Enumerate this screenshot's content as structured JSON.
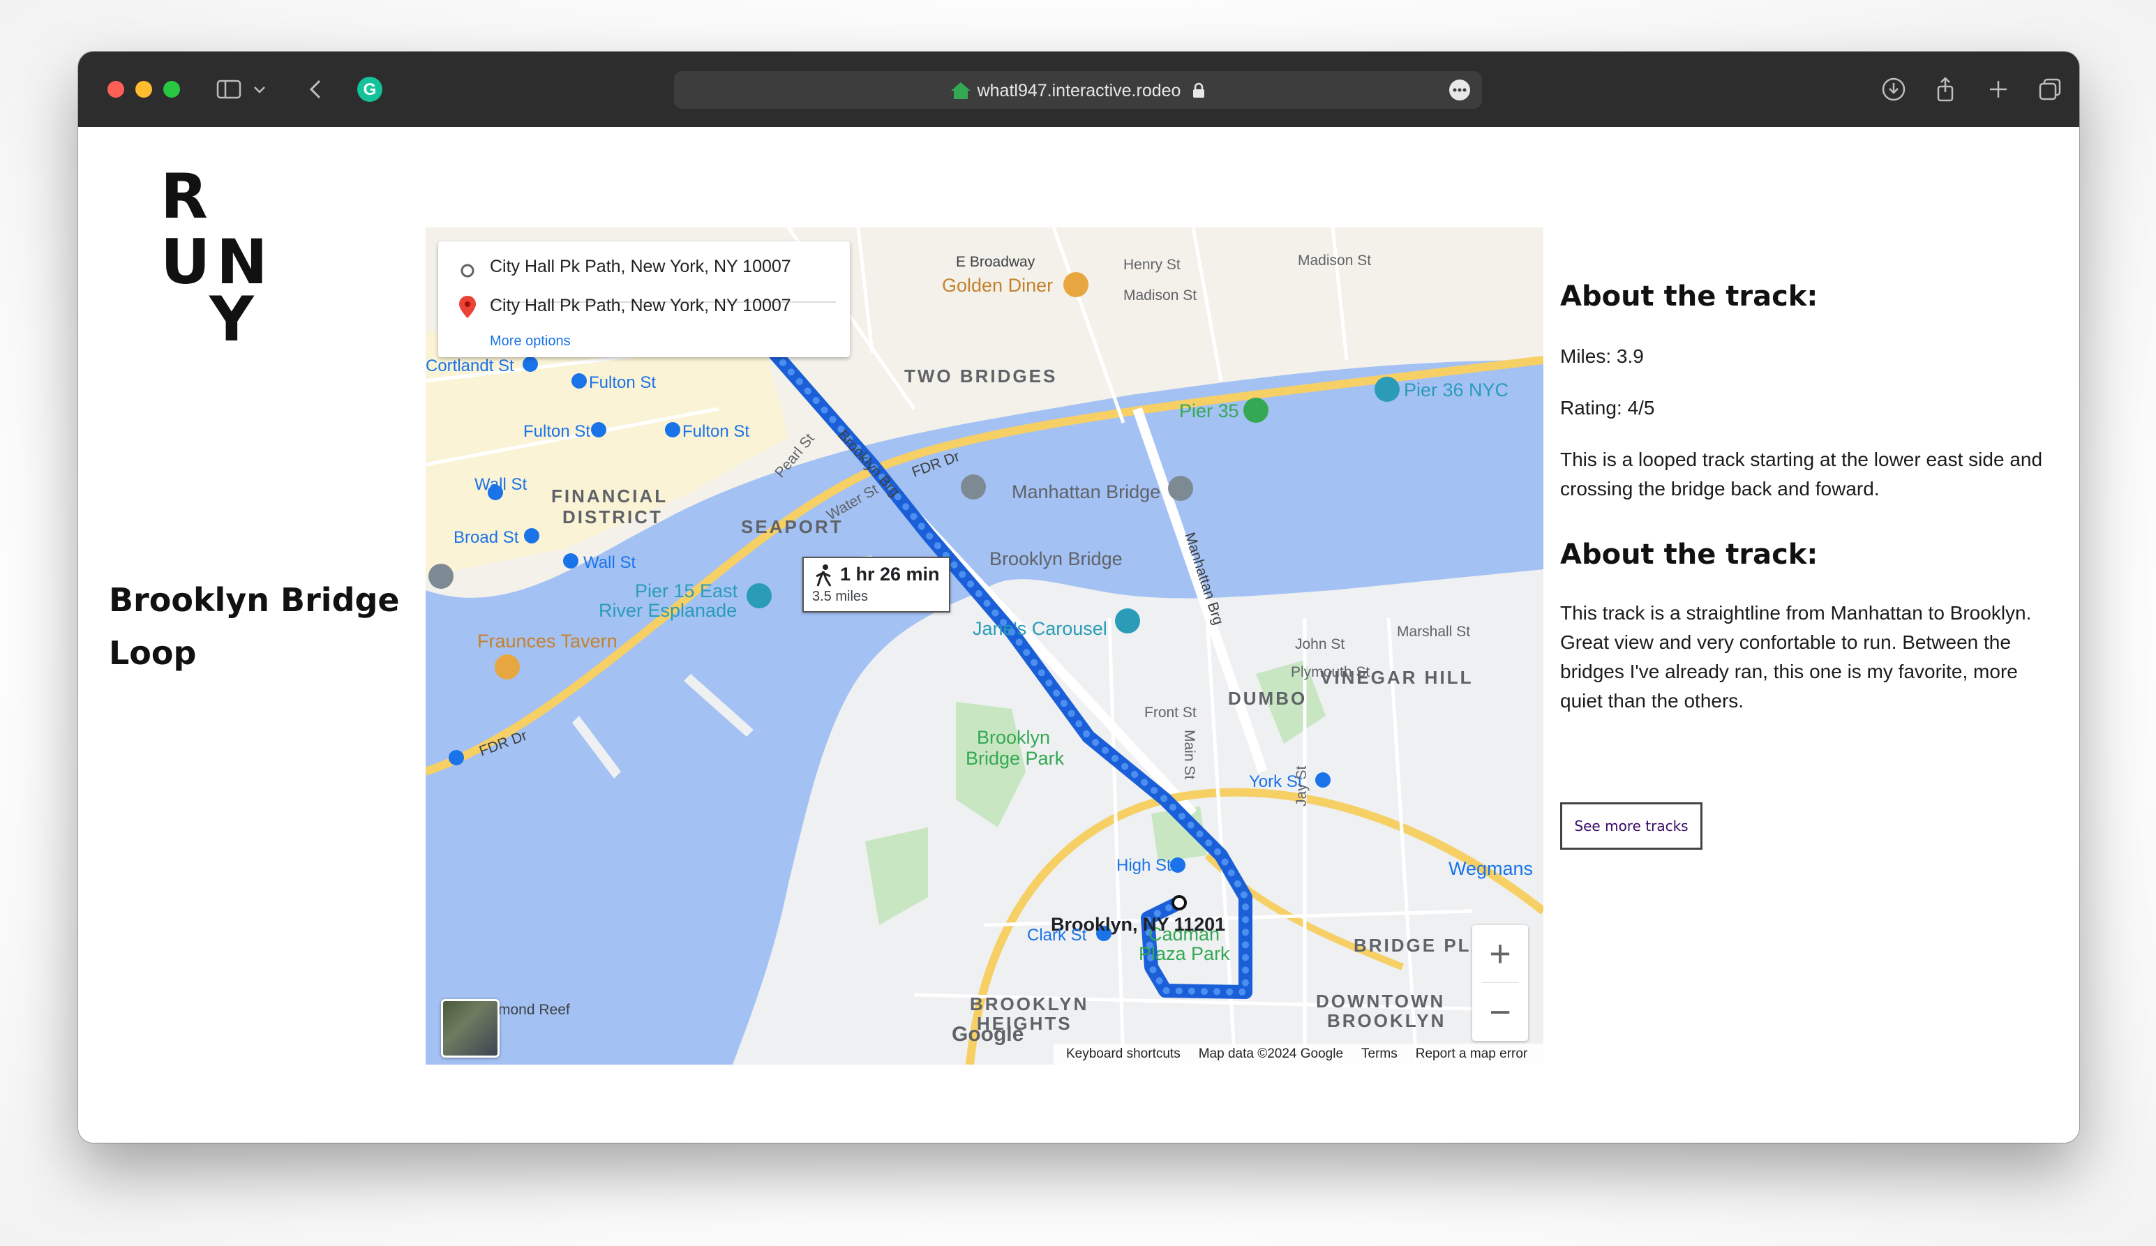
{
  "browser": {
    "url": "whatl947.interactive.rodeo"
  },
  "logo": {
    "letters": [
      "R",
      "U",
      "N",
      "Y"
    ]
  },
  "page": {
    "title": "Brooklyn Bridge Loop"
  },
  "map": {
    "origin": "City Hall Pk Path, New York, NY 10007",
    "destination": "City Hall Pk Path, New York, NY 10007",
    "more_options": "More options",
    "route_time": "1 hr 26 min",
    "route_distance": "3.5 miles",
    "end_label": "Brooklyn, NY 11201",
    "footer": {
      "shortcuts": "Keyboard shortcuts",
      "map_data": "Map data ©2024 Google",
      "terms": "Terms",
      "report": "Report a map error"
    },
    "google": "Google",
    "zoom_in": "+",
    "zoom_out": "−",
    "labels": {
      "two_bridges": "TWO BRIDGES",
      "financial": "FINANCIAL",
      "district": "DISTRICT",
      "seaport": "SEAPORT",
      "dumbo": "DUMBO",
      "vinegar_hill": "VINEGAR HILL",
      "brooklyn_heights_1": "BROOKLYN",
      "brooklyn_heights_2": "HEIGHTS",
      "downtown_1": "DOWNTOWN",
      "downtown_2": "BROOKLYN",
      "bridge_plaza": "BRIDGE PLA",
      "manhattan_bridge": "Manhattan Bridge",
      "brooklyn_bridge": "Brooklyn Bridge",
      "janes_carousel": "Jane's Carousel",
      "brooklyn_bridge_park_1": "Brooklyn",
      "brooklyn_bridge_park_2": "Bridge Park",
      "pier15_1": "Pier 15 East",
      "pier15_2": "River Esplanade",
      "fraunces": "Fraunces Tavern",
      "golden_diner": "Golden Diner",
      "pier35": "Pier 35",
      "pier36": "Pier 36 NYC",
      "cadman_1": "Cadman",
      "cadman_2": "Plaza Park",
      "wegmans": "Wegmans",
      "fulton_st_1": "Fulton St",
      "fulton_st_2": "Fulton St",
      "fulton_st_3": "Fulton St",
      "wall_st_1": "Wall St",
      "wall_st_2": "Wall St",
      "broad_st": "Broad St",
      "cortlandt": "Cortlandt St",
      "york_st": "York St",
      "high_st": "High St",
      "clark_st": "Clark St",
      "fdr_1": "FDR Dr",
      "fdr_2": "FDR Dr",
      "e_broadway": "E Broadway",
      "pearl_st": "Pearl St",
      "water_st": "Water St",
      "brooklyn_brg": "Brooklyn Brg",
      "manhattan_brg": "Manhattan Brg",
      "diamond_reef": "mond Reef",
      "henry_st": "Henry St",
      "madison_st": "Madison St",
      "jay_st": "Jay St",
      "main_st": "Main St",
      "front_st": "Front St",
      "plymouth_st": "Plymouth St",
      "john_st": "John St",
      "marshall_st": "Marshall St"
    }
  },
  "info": {
    "heading1": "About the track:",
    "miles": "Miles: 3.9",
    "rating": "Rating: 4/5",
    "desc1": "This is a looped track starting at the lower east side and crossing the bridge back and foward.",
    "heading2": "About the track:",
    "desc2": "This track is a straightline from Manhattan to Brooklyn. Great view and very confortable to run. Between the bridges I've already ran, this one is my favorite, more quiet than the others.",
    "button": "See more tracks"
  }
}
